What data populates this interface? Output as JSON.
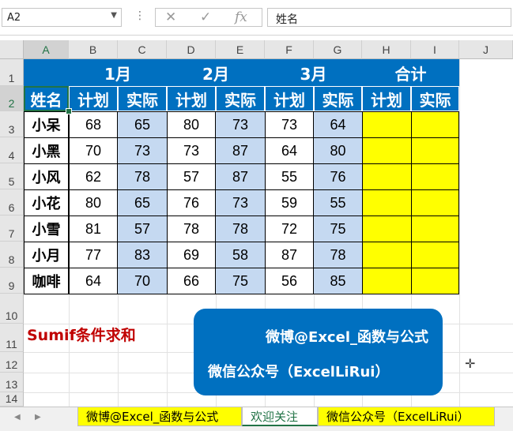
{
  "formula_bar": {
    "name_box": "A2",
    "fx": "fx",
    "content": "姓名"
  },
  "columns": [
    "A",
    "B",
    "C",
    "D",
    "E",
    "F",
    "G",
    "H",
    "I",
    "J"
  ],
  "rows": [
    "1",
    "2",
    "3",
    "4",
    "5",
    "6",
    "7",
    "8",
    "9",
    "10",
    "11",
    "12",
    "13",
    "14"
  ],
  "headers": {
    "months": [
      "1月",
      "2月",
      "3月",
      "合计"
    ],
    "name": "姓名",
    "plan": "计划",
    "actual": "实际"
  },
  "table": [
    {
      "name": "小呆",
      "values": [
        "68",
        "65",
        "80",
        "73",
        "73",
        "64"
      ]
    },
    {
      "name": "小黑",
      "values": [
        "70",
        "73",
        "73",
        "87",
        "64",
        "80"
      ]
    },
    {
      "name": "小风",
      "values": [
        "62",
        "78",
        "57",
        "87",
        "55",
        "76"
      ]
    },
    {
      "name": "小花",
      "values": [
        "80",
        "65",
        "76",
        "73",
        "59",
        "55"
      ]
    },
    {
      "name": "小雪",
      "values": [
        "81",
        "57",
        "78",
        "78",
        "72",
        "75"
      ]
    },
    {
      "name": "小月",
      "values": [
        "77",
        "83",
        "69",
        "58",
        "87",
        "78"
      ]
    },
    {
      "name": "咖啡",
      "values": [
        "64",
        "70",
        "66",
        "75",
        "56",
        "85"
      ]
    }
  ],
  "note": "Sumif条件求和",
  "banner": {
    "line1": "微博@Excel_函数与公式",
    "line2": "微信公众号（ExcelLiRui）"
  },
  "tabs": [
    "微博@Excel_函数与公式",
    "欢迎关注",
    "微信公众号（ExcelLiRui）"
  ],
  "colors": {
    "header_blue": "#0070c0",
    "actual_fill": "#c5d9f1",
    "total_fill": "#ffff00",
    "note_red": "#c00000",
    "excel_green": "#217346"
  }
}
